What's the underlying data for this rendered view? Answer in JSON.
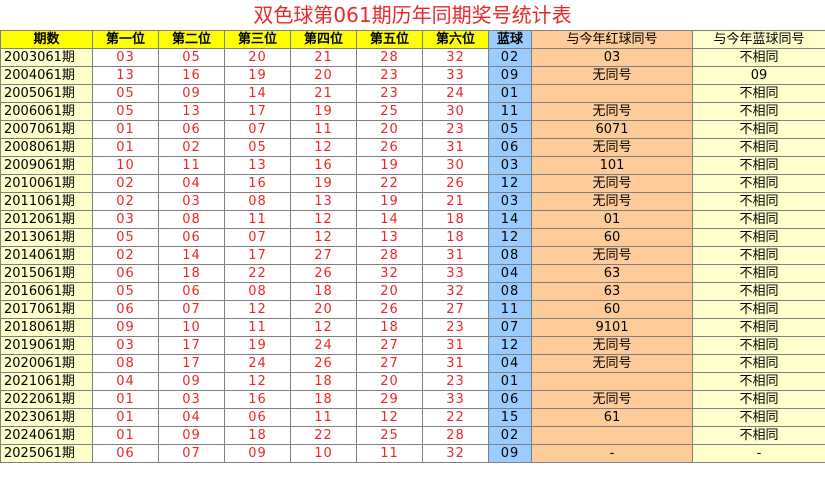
{
  "title": "双色球第061期历年同期奖号统计表",
  "headers": [
    "期数",
    "第一位",
    "第二位",
    "第三位",
    "第四位",
    "第五位",
    "第六位",
    "蓝球",
    "与今年红球同号",
    "与今年蓝球同号"
  ],
  "rows": [
    {
      "period": "2003061期",
      "reds": [
        "03",
        "05",
        "20",
        "21",
        "28",
        "32"
      ],
      "blue": "02",
      "same_red": "03",
      "same_blue": "不相同"
    },
    {
      "period": "2004061期",
      "reds": [
        "13",
        "16",
        "19",
        "20",
        "23",
        "33"
      ],
      "blue": "09",
      "same_red": "无同号",
      "same_blue": "09"
    },
    {
      "period": "2005061期",
      "reds": [
        "05",
        "09",
        "14",
        "21",
        "23",
        "24"
      ],
      "blue": "01",
      "same_red": "",
      "same_blue": "不相同"
    },
    {
      "period": "2006061期",
      "reds": [
        "05",
        "13",
        "17",
        "19",
        "25",
        "30"
      ],
      "blue": "11",
      "same_red": "无同号",
      "same_blue": "不相同"
    },
    {
      "period": "2007061期",
      "reds": [
        "01",
        "06",
        "07",
        "11",
        "20",
        "23"
      ],
      "blue": "05",
      "same_red": "6071",
      "same_blue": "不相同"
    },
    {
      "period": "2008061期",
      "reds": [
        "01",
        "02",
        "05",
        "12",
        "26",
        "31"
      ],
      "blue": "06",
      "same_red": "无同号",
      "same_blue": "不相同"
    },
    {
      "period": "2009061期",
      "reds": [
        "10",
        "11",
        "13",
        "16",
        "19",
        "30"
      ],
      "blue": "03",
      "same_red": "101",
      "same_blue": "不相同"
    },
    {
      "period": "2010061期",
      "reds": [
        "02",
        "04",
        "16",
        "19",
        "22",
        "26"
      ],
      "blue": "12",
      "same_red": "无同号",
      "same_blue": "不相同"
    },
    {
      "period": "2011061期",
      "reds": [
        "02",
        "03",
        "08",
        "13",
        "19",
        "21"
      ],
      "blue": "03",
      "same_red": "无同号",
      "same_blue": "不相同"
    },
    {
      "period": "2012061期",
      "reds": [
        "03",
        "08",
        "11",
        "12",
        "14",
        "18"
      ],
      "blue": "14",
      "same_red": "01",
      "same_blue": "不相同"
    },
    {
      "period": "2013061期",
      "reds": [
        "05",
        "06",
        "07",
        "12",
        "13",
        "18"
      ],
      "blue": "12",
      "same_red": "60",
      "same_blue": "不相同"
    },
    {
      "period": "2014061期",
      "reds": [
        "02",
        "14",
        "17",
        "27",
        "28",
        "31"
      ],
      "blue": "08",
      "same_red": "无同号",
      "same_blue": "不相同"
    },
    {
      "period": "2015061期",
      "reds": [
        "06",
        "18",
        "22",
        "26",
        "32",
        "33"
      ],
      "blue": "04",
      "same_red": "63",
      "same_blue": "不相同"
    },
    {
      "period": "2016061期",
      "reds": [
        "05",
        "06",
        "08",
        "18",
        "20",
        "32"
      ],
      "blue": "08",
      "same_red": "63",
      "same_blue": "不相同"
    },
    {
      "period": "2017061期",
      "reds": [
        "06",
        "07",
        "12",
        "20",
        "26",
        "27"
      ],
      "blue": "11",
      "same_red": "60",
      "same_blue": "不相同"
    },
    {
      "period": "2018061期",
      "reds": [
        "09",
        "10",
        "11",
        "12",
        "18",
        "23"
      ],
      "blue": "07",
      "same_red": "9101",
      "same_blue": "不相同"
    },
    {
      "period": "2019061期",
      "reds": [
        "03",
        "17",
        "19",
        "24",
        "27",
        "31"
      ],
      "blue": "12",
      "same_red": "无同号",
      "same_blue": "不相同"
    },
    {
      "period": "2020061期",
      "reds": [
        "08",
        "17",
        "24",
        "26",
        "27",
        "31"
      ],
      "blue": "04",
      "same_red": "无同号",
      "same_blue": "不相同"
    },
    {
      "period": "2021061期",
      "reds": [
        "04",
        "09",
        "12",
        "18",
        "20",
        "23"
      ],
      "blue": "01",
      "same_red": "",
      "same_blue": "不相同"
    },
    {
      "period": "2022061期",
      "reds": [
        "01",
        "03",
        "16",
        "18",
        "29",
        "33"
      ],
      "blue": "06",
      "same_red": "无同号",
      "same_blue": "不相同"
    },
    {
      "period": "2023061期",
      "reds": [
        "01",
        "04",
        "06",
        "11",
        "12",
        "22"
      ],
      "blue": "15",
      "same_red": "61",
      "same_blue": "不相同"
    },
    {
      "period": "2024061期",
      "reds": [
        "01",
        "09",
        "18",
        "22",
        "25",
        "28"
      ],
      "blue": "02",
      "same_red": "",
      "same_blue": "不相同"
    },
    {
      "period": "2025061期",
      "reds": [
        "06",
        "07",
        "09",
        "10",
        "11",
        "32"
      ],
      "blue": "09",
      "same_red": "-",
      "same_blue": "-"
    }
  ],
  "colors": {
    "title_red": "#e8292b",
    "header_yellow": "#ffff00",
    "blue_col": "#99ccff",
    "same_red_col": "#ffcc99",
    "light_yellow": "#ffffcc",
    "red_digits": "#e8292b"
  }
}
